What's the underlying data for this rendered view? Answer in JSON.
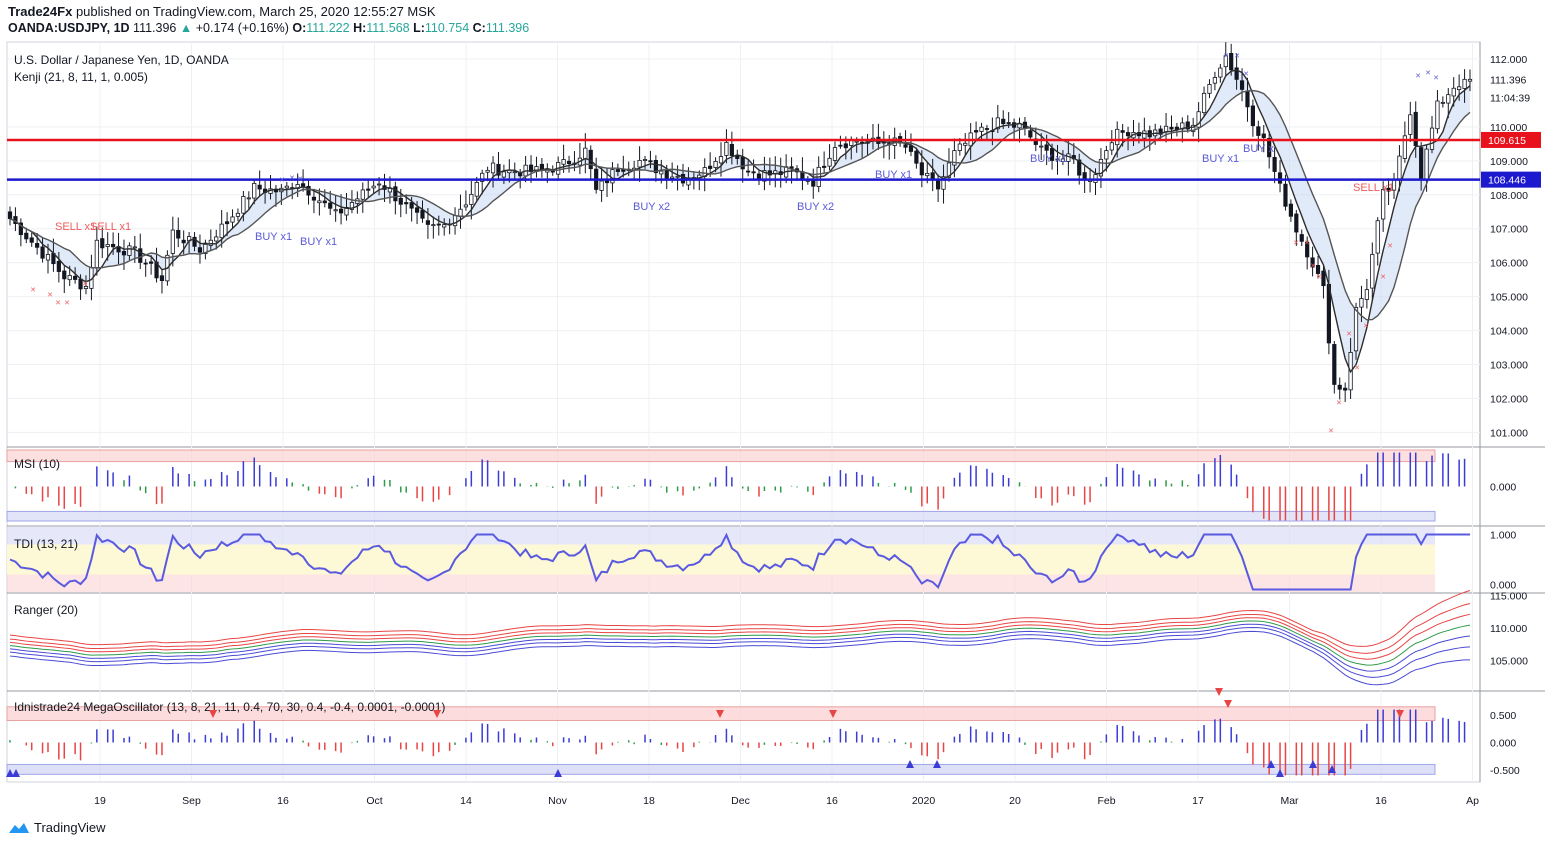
{
  "header": {
    "publisher": "Trade24Fx",
    "published_text": "published on TradingView.com, March 25, 2020 12:55:27 MSK",
    "symbol": "OANDA:USDJPY, 1D",
    "last": "111.396",
    "change": "+0.174 (+0.16%)",
    "o_label": "O:",
    "o": "111.222",
    "h_label": "H:",
    "h": "111.568",
    "l_label": "L:",
    "l": "110.754",
    "c_label": "C:",
    "c": "111.396"
  },
  "branding": {
    "name": "TradingView",
    "icon": "tradingview-logo-icon"
  },
  "colors": {
    "bull": "#ffffff",
    "bear": "#131722",
    "red_line": "#e8121d",
    "blue_line": "#1d19cf",
    "buy": "#5b5bd6",
    "sell": "#f05b5b"
  },
  "chart_data": [
    {
      "type": "candlestick",
      "title": "U.S. Dollar / Japanese Yen, 1D, OANDA",
      "indicator_label": "Kenji (21, 8, 11, 1, 0.005)",
      "ylim": [
        100.6,
        112.5
      ],
      "y_ticks": [
        "112.000",
        "110.000",
        "109.000",
        "108.000",
        "107.000",
        "106.000",
        "105.000",
        "104.000",
        "103.000",
        "102.000",
        "101.000"
      ],
      "x_ticks": [
        "19",
        "Sep",
        "16",
        "Oct",
        "14",
        "Nov",
        "18",
        "Dec",
        "16",
        "2020",
        "20",
        "Feb",
        "17",
        "Mar",
        "16",
        "Ap"
      ],
      "horizontal_lines": [
        {
          "value": 109.615,
          "label": "109.615",
          "color": "#e8121d"
        },
        {
          "value": 108.446,
          "label": "108.446",
          "color": "#1d19cf"
        }
      ],
      "price_labels": [
        "111.396",
        "11:04:39"
      ],
      "annotations": [
        {
          "text": "SELL x1",
          "kind": "sell"
        },
        {
          "text": "SELL x1",
          "kind": "sell"
        },
        {
          "text": "BUY x1",
          "kind": "buy"
        },
        {
          "text": "BUY x1",
          "kind": "buy"
        },
        {
          "text": "BUY x2",
          "kind": "buy"
        },
        {
          "text": "BUY x2",
          "kind": "buy"
        },
        {
          "text": "BUY x1",
          "kind": "buy"
        },
        {
          "text": "BUY x1",
          "kind": "buy"
        },
        {
          "text": "BUY x1",
          "kind": "buy"
        },
        {
          "text": "BUY x",
          "kind": "buy"
        },
        {
          "text": "SELL x1",
          "kind": "sell"
        }
      ],
      "close_anchors": [
        [
          0,
          107.3
        ],
        [
          10,
          105.6
        ],
        [
          14,
          105.3
        ],
        [
          16,
          106.6
        ],
        [
          23,
          106.3
        ],
        [
          28,
          105.5
        ],
        [
          30,
          106.9
        ],
        [
          35,
          106.4
        ],
        [
          40,
          107.2
        ],
        [
          45,
          108.2
        ],
        [
          50,
          108.1
        ],
        [
          53,
          108.4
        ],
        [
          56,
          108.0
        ],
        [
          60,
          107.4
        ],
        [
          64,
          107.9
        ],
        [
          68,
          108.4
        ],
        [
          72,
          107.8
        ],
        [
          77,
          107.0
        ],
        [
          80,
          107.1
        ],
        [
          84,
          107.8
        ],
        [
          88,
          108.8
        ],
        [
          92,
          108.7
        ],
        [
          98,
          108.7
        ],
        [
          102,
          108.9
        ],
        [
          106,
          109.3
        ],
        [
          108,
          108.1
        ],
        [
          112,
          108.8
        ],
        [
          116,
          109.0
        ],
        [
          120,
          108.7
        ],
        [
          124,
          108.5
        ],
        [
          128,
          108.7
        ],
        [
          132,
          109.5
        ],
        [
          136,
          108.7
        ],
        [
          140,
          108.6
        ],
        [
          144,
          108.7
        ],
        [
          148,
          108.4
        ],
        [
          152,
          109.5
        ],
        [
          156,
          109.6
        ],
        [
          160,
          109.5
        ],
        [
          162,
          109.6
        ],
        [
          165,
          109.4
        ],
        [
          168,
          108.6
        ],
        [
          171,
          108.2
        ],
        [
          174,
          109.2
        ],
        [
          178,
          109.8
        ],
        [
          182,
          110.1
        ],
        [
          186,
          110.0
        ],
        [
          188,
          109.7
        ],
        [
          190,
          109.3
        ],
        [
          193,
          109.1
        ],
        [
          196,
          109.0
        ],
        [
          198,
          108.4
        ],
        [
          200,
          108.7
        ],
        [
          203,
          109.7
        ],
        [
          206,
          109.9
        ],
        [
          210,
          109.8
        ],
        [
          214,
          109.9
        ],
        [
          218,
          110.1
        ],
        [
          222,
          111.6
        ],
        [
          224,
          112.1
        ],
        [
          227,
          111.1
        ],
        [
          229,
          110.2
        ],
        [
          231,
          109.6
        ],
        [
          234,
          108.2
        ],
        [
          237,
          107.0
        ],
        [
          240,
          106.0
        ],
        [
          242,
          105.2
        ],
        [
          244,
          102.4
        ],
        [
          246,
          102.3
        ],
        [
          248,
          104.6
        ],
        [
          250,
          105.3
        ],
        [
          253,
          108.0
        ],
        [
          255,
          108.3
        ],
        [
          258,
          110.5
        ],
        [
          260,
          108.6
        ],
        [
          263,
          110.6
        ],
        [
          266,
          111.2
        ],
        [
          268,
          111.4
        ]
      ],
      "series": [
        {
          "name": "Kenji fast",
          "color": "#2d2d2d"
        },
        {
          "name": "Kenji slow",
          "color": "#555555"
        }
      ]
    },
    {
      "type": "histogram",
      "title": "MSI (10)",
      "ylim": [
        -0.85,
        0.85
      ],
      "y_ticks": [
        "0.000"
      ]
    },
    {
      "type": "line",
      "title": "TDI (13, 21)",
      "ylim": [
        -0.15,
        1.15
      ],
      "y_ticks": [
        "1.000",
        "0.000"
      ]
    },
    {
      "type": "line",
      "title": "Ranger (20)",
      "ylim": [
        100.5,
        115.2
      ],
      "y_ticks": [
        "115.000",
        "110.000",
        "105.000"
      ]
    },
    {
      "type": "histogram",
      "title": "Idnistrade24 MegaOscillator (13, 8, 21, 11, 0.4, 70, 30, 0.4, -0.4, 0.0001, -0.0001)",
      "ylim": [
        -0.72,
        0.92
      ],
      "y_ticks": [
        "0.500",
        "0.000",
        "-0.500"
      ]
    }
  ]
}
